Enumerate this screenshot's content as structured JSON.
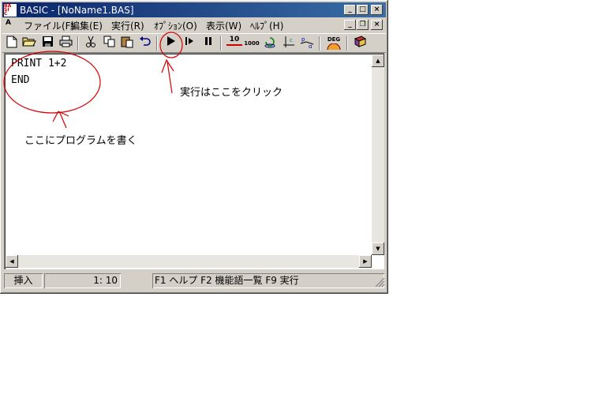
{
  "window": {
    "title": "BASIC - [NoName1.BAS]",
    "icon_letters": [
      "BA",
      "SI",
      "C"
    ],
    "controls": {
      "minimize": "_",
      "maximize": "□",
      "close": "×"
    }
  },
  "menubar": {
    "app_icon": "A",
    "items": [
      "ファイル(F)",
      "編集(E)",
      "実行(R)",
      "ｵﾌﾟｼｮﾝ(O)",
      "表示(W)",
      "ﾍﾙﾌﾟ(H)"
    ],
    "mdi_controls": {
      "minimize": "_",
      "restore": "❐",
      "close": "×"
    }
  },
  "toolbar": {
    "buttons": [
      "new-file-icon",
      "open-folder-icon",
      "save-icon",
      "print-icon",
      "cut-icon",
      "copy-icon",
      "paste-icon",
      "undo-icon",
      "run-icon",
      "step-icon",
      "pause-icon",
      "number10-icon",
      "number1000-icon",
      "rotate-icon",
      "axis-icon",
      "graph-icon",
      "deg-icon",
      "book-icon"
    ],
    "deg_label": "DEG",
    "n10_label": "10",
    "n1000_label": "1000"
  },
  "editor": {
    "lines": [
      "PRINT 1+2",
      "END"
    ]
  },
  "statusbar": {
    "mode": "挿入",
    "position": "1:  10",
    "help": "F1 ヘルプ  F2 機能語一覧  F9 実行"
  },
  "annotations": {
    "run_hint": "実行はここをクリック",
    "write_hint": "ここにプログラムを書く",
    "color": "#d40000"
  }
}
